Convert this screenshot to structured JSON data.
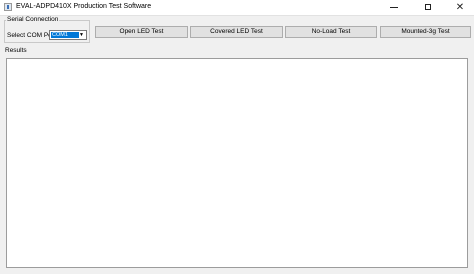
{
  "window": {
    "title": "EVAL-ADPD410X Production Test Software",
    "minimize_glyph": "",
    "maximize_glyph": "",
    "close_glyph": "✕"
  },
  "serial": {
    "group_title": "Serial Connection",
    "com_label": "Select COM Port",
    "com_value": "COM1",
    "dropdown_arrow": "▼"
  },
  "buttons": {
    "open_led": "Open LED Test",
    "covered_led": "Covered LED Test",
    "no_load": "No-Load Test",
    "mounted": "Mounted-3g Test"
  },
  "results": {
    "label": "Results",
    "content": ""
  }
}
